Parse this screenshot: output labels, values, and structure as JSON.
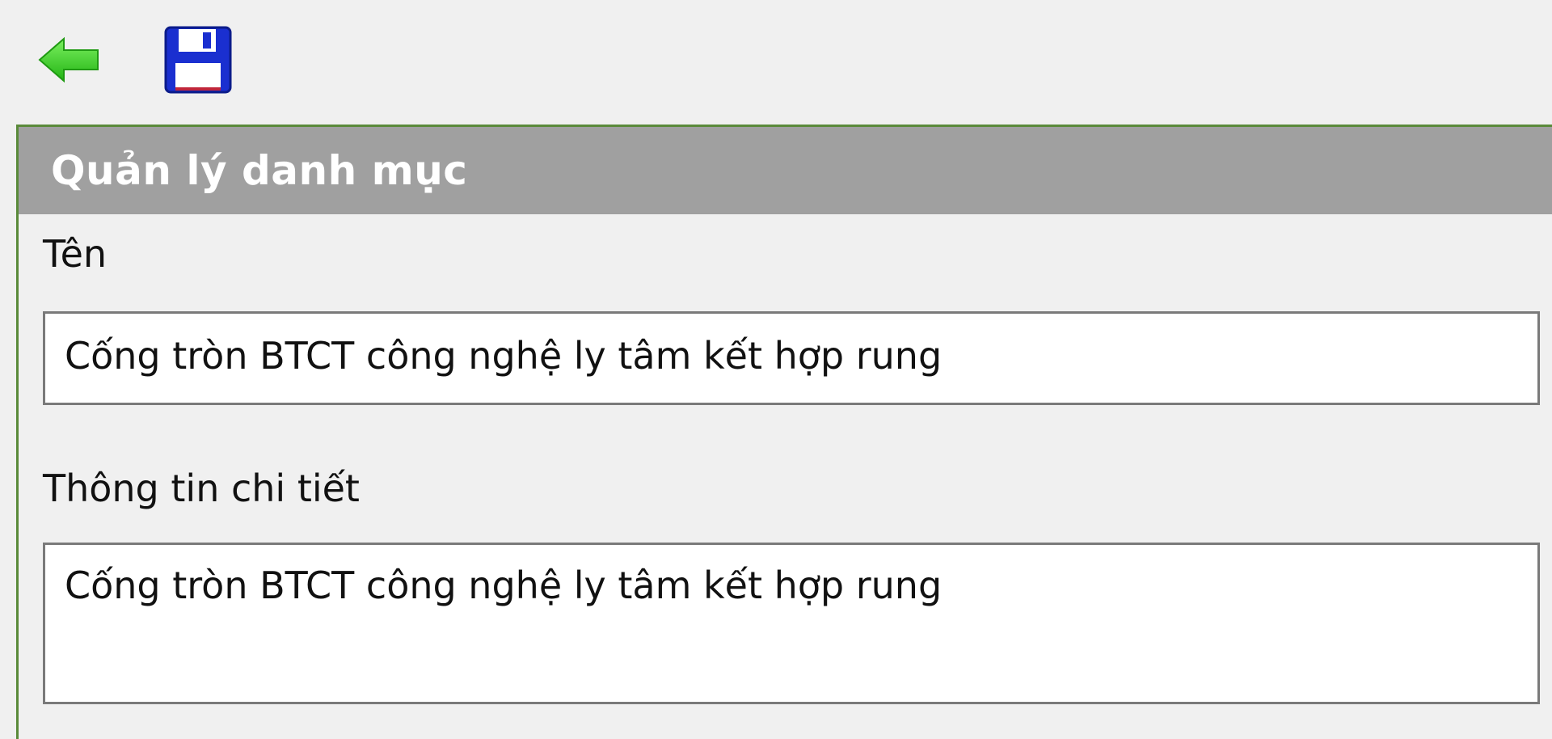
{
  "toolbar": {
    "back_icon": "back-arrow-icon",
    "save_icon": "floppy-disk-icon",
    "colors": {
      "back_arrow": "#3fcf2a",
      "save_disk": "#1a2fd0"
    }
  },
  "panel": {
    "title": "Quản lý danh mục",
    "header_color": "#a0a0a0",
    "border_color": "#5a8a3a"
  },
  "form": {
    "name_label": "Tên",
    "name_value": "Cống tròn BTCT công nghệ ly tâm kết hợp rung",
    "detail_label": "Thông tin chi tiết",
    "detail_value": "Cống tròn BTCT công nghệ ly tâm kết hợp rung"
  }
}
